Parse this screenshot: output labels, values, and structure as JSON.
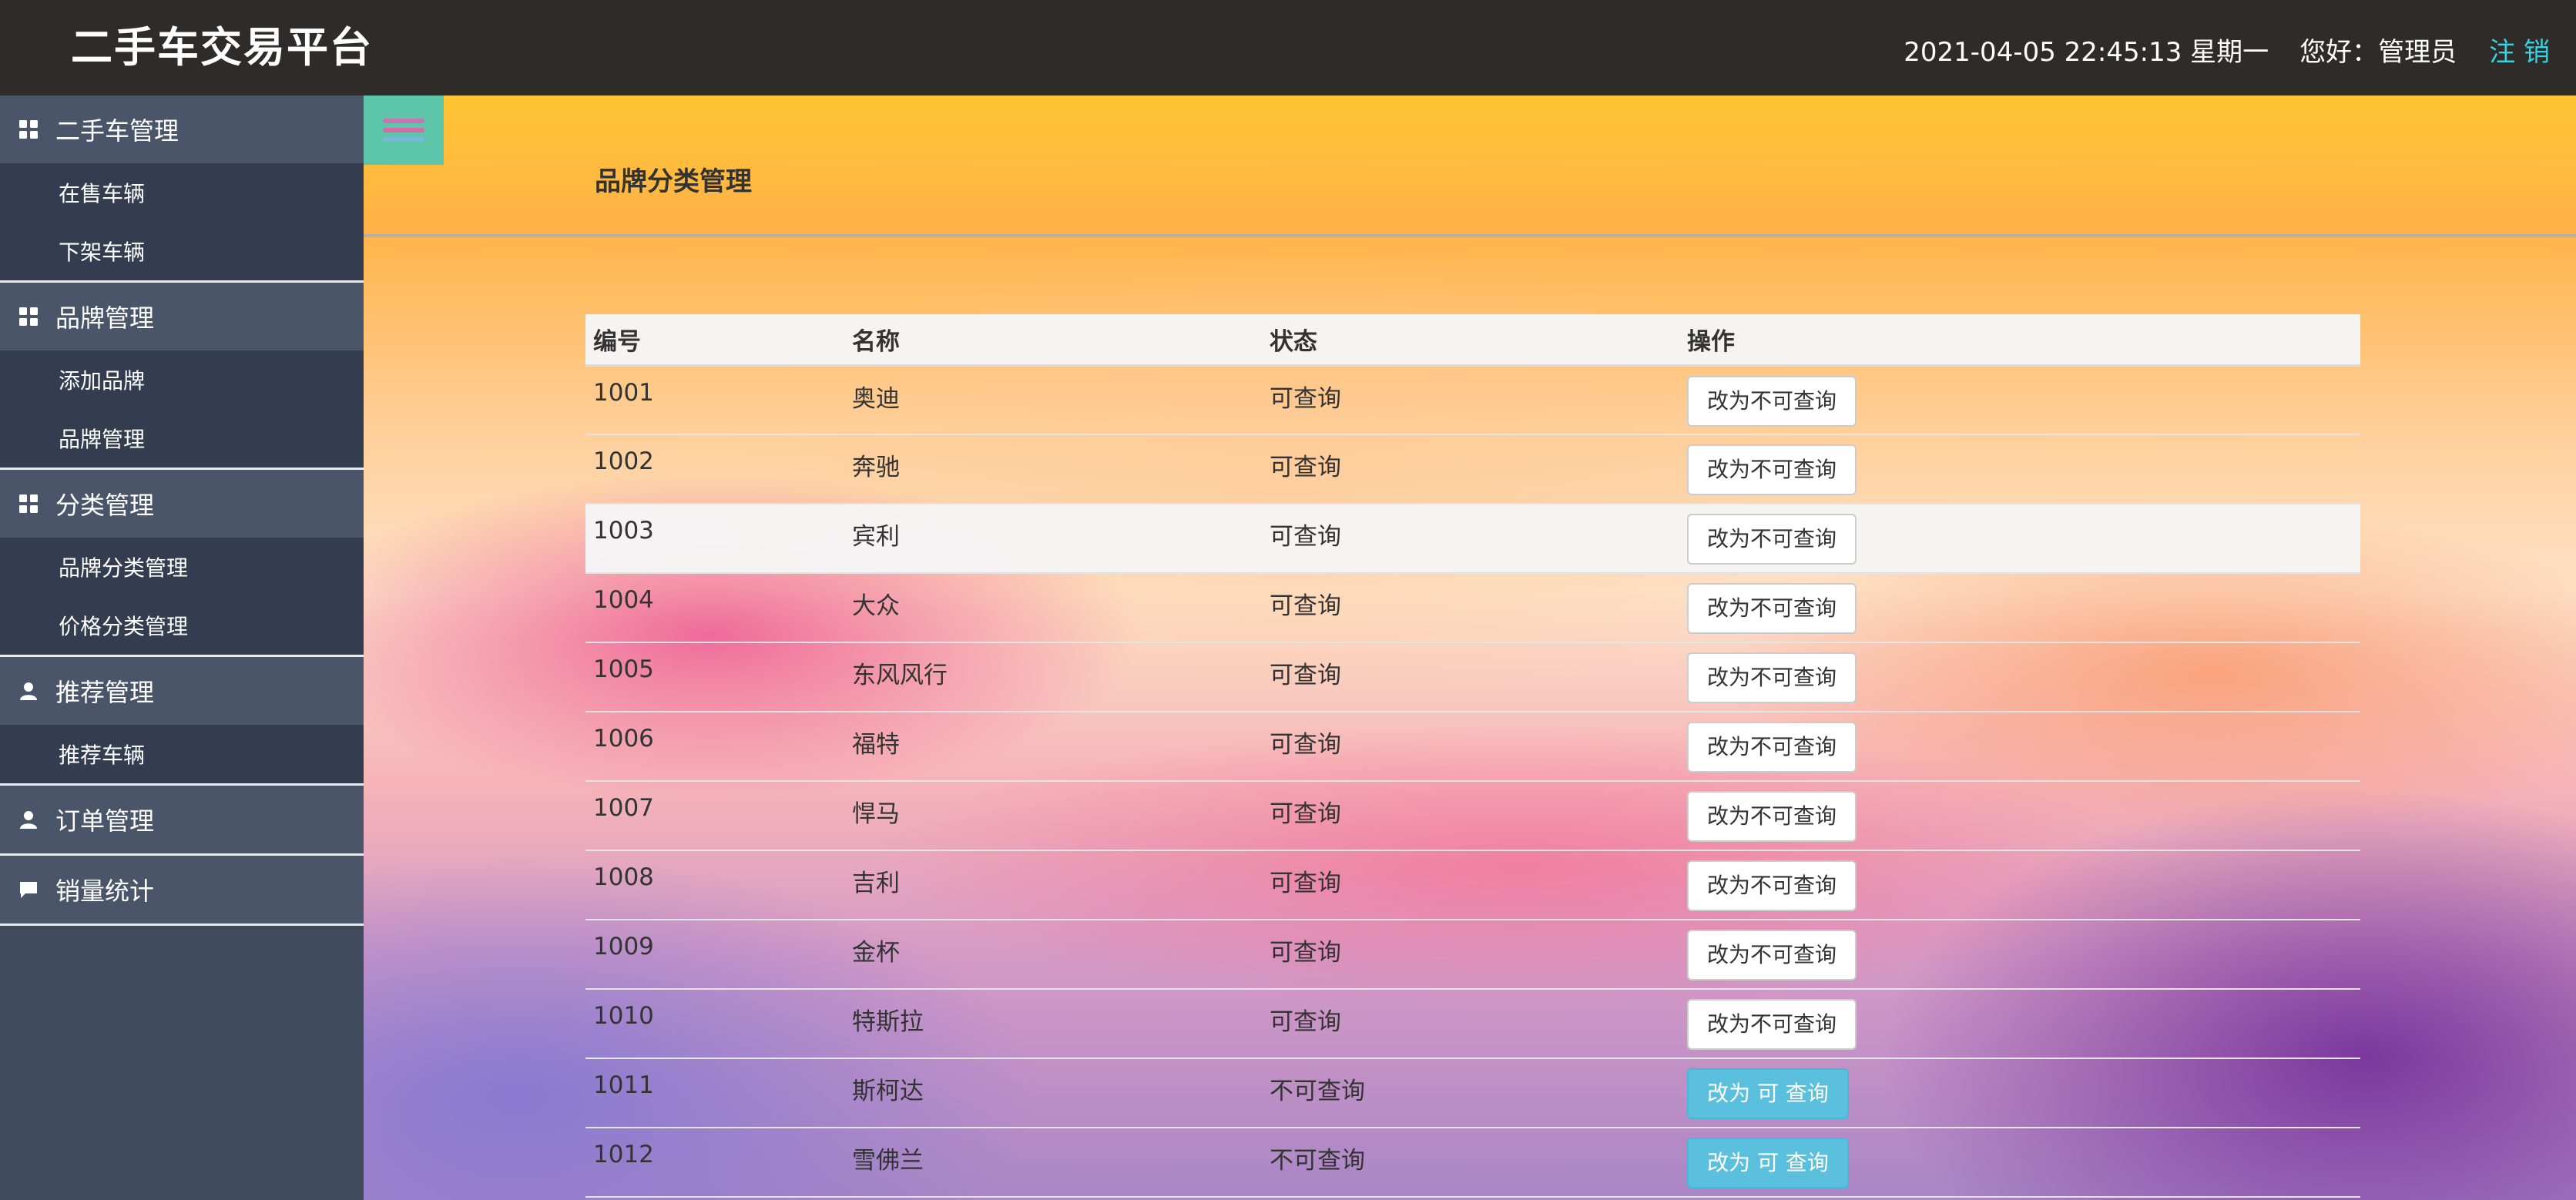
{
  "header": {
    "title": "二手车交易平台",
    "datetime": "2021-04-05 22:45:13 星期一",
    "greeting": "您好：管理员",
    "logout": "注 销"
  },
  "sidebar": {
    "groups": [
      {
        "label": "二手车管理",
        "icon": "grid-icon",
        "items": [
          "在售车辆",
          "下架车辆"
        ]
      },
      {
        "label": "品牌管理",
        "icon": "grid-icon",
        "items": [
          "添加品牌",
          "品牌管理"
        ]
      },
      {
        "label": "分类管理",
        "icon": "grid-icon",
        "items": [
          "品牌分类管理",
          "价格分类管理"
        ]
      },
      {
        "label": "推荐管理",
        "icon": "user-icon",
        "items": [
          "推荐车辆"
        ]
      },
      {
        "label": "订单管理",
        "icon": "user-icon",
        "items": []
      },
      {
        "label": "销量统计",
        "icon": "comment-icon",
        "items": []
      }
    ]
  },
  "main": {
    "page_title": "品牌分类管理",
    "table": {
      "headers": [
        "编号",
        "名称",
        "状态",
        "操作"
      ],
      "rows": [
        {
          "id": "1001",
          "name": "奥迪",
          "status": "可查询",
          "action": "改为不可查询",
          "queryable": true
        },
        {
          "id": "1002",
          "name": "奔驰",
          "status": "可查询",
          "action": "改为不可查询",
          "queryable": true
        },
        {
          "id": "1003",
          "name": "宾利",
          "status": "可查询",
          "action": "改为不可查询",
          "queryable": true
        },
        {
          "id": "1004",
          "name": "大众",
          "status": "可查询",
          "action": "改为不可查询",
          "queryable": true
        },
        {
          "id": "1005",
          "name": "东风风行",
          "status": "可查询",
          "action": "改为不可查询",
          "queryable": true
        },
        {
          "id": "1006",
          "name": "福特",
          "status": "可查询",
          "action": "改为不可查询",
          "queryable": true
        },
        {
          "id": "1007",
          "name": "悍马",
          "status": "可查询",
          "action": "改为不可查询",
          "queryable": true
        },
        {
          "id": "1008",
          "name": "吉利",
          "status": "可查询",
          "action": "改为不可查询",
          "queryable": true
        },
        {
          "id": "1009",
          "name": "金杯",
          "status": "可查询",
          "action": "改为不可查询",
          "queryable": true
        },
        {
          "id": "1010",
          "name": "特斯拉",
          "status": "可查询",
          "action": "改为不可查询",
          "queryable": true
        },
        {
          "id": "1011",
          "name": "斯柯达",
          "status": "不可查询",
          "action": "改为 可 查询",
          "queryable": false
        },
        {
          "id": "1012",
          "name": "雪佛兰",
          "status": "不可查询",
          "action": "改为 可 查询",
          "queryable": false
        }
      ]
    }
  },
  "colors": {
    "header_bg": "#2f2b28",
    "sidebar_bg": "#3f4a5c",
    "logout": "#35d3e3",
    "info_button": "#5bc0de"
  }
}
